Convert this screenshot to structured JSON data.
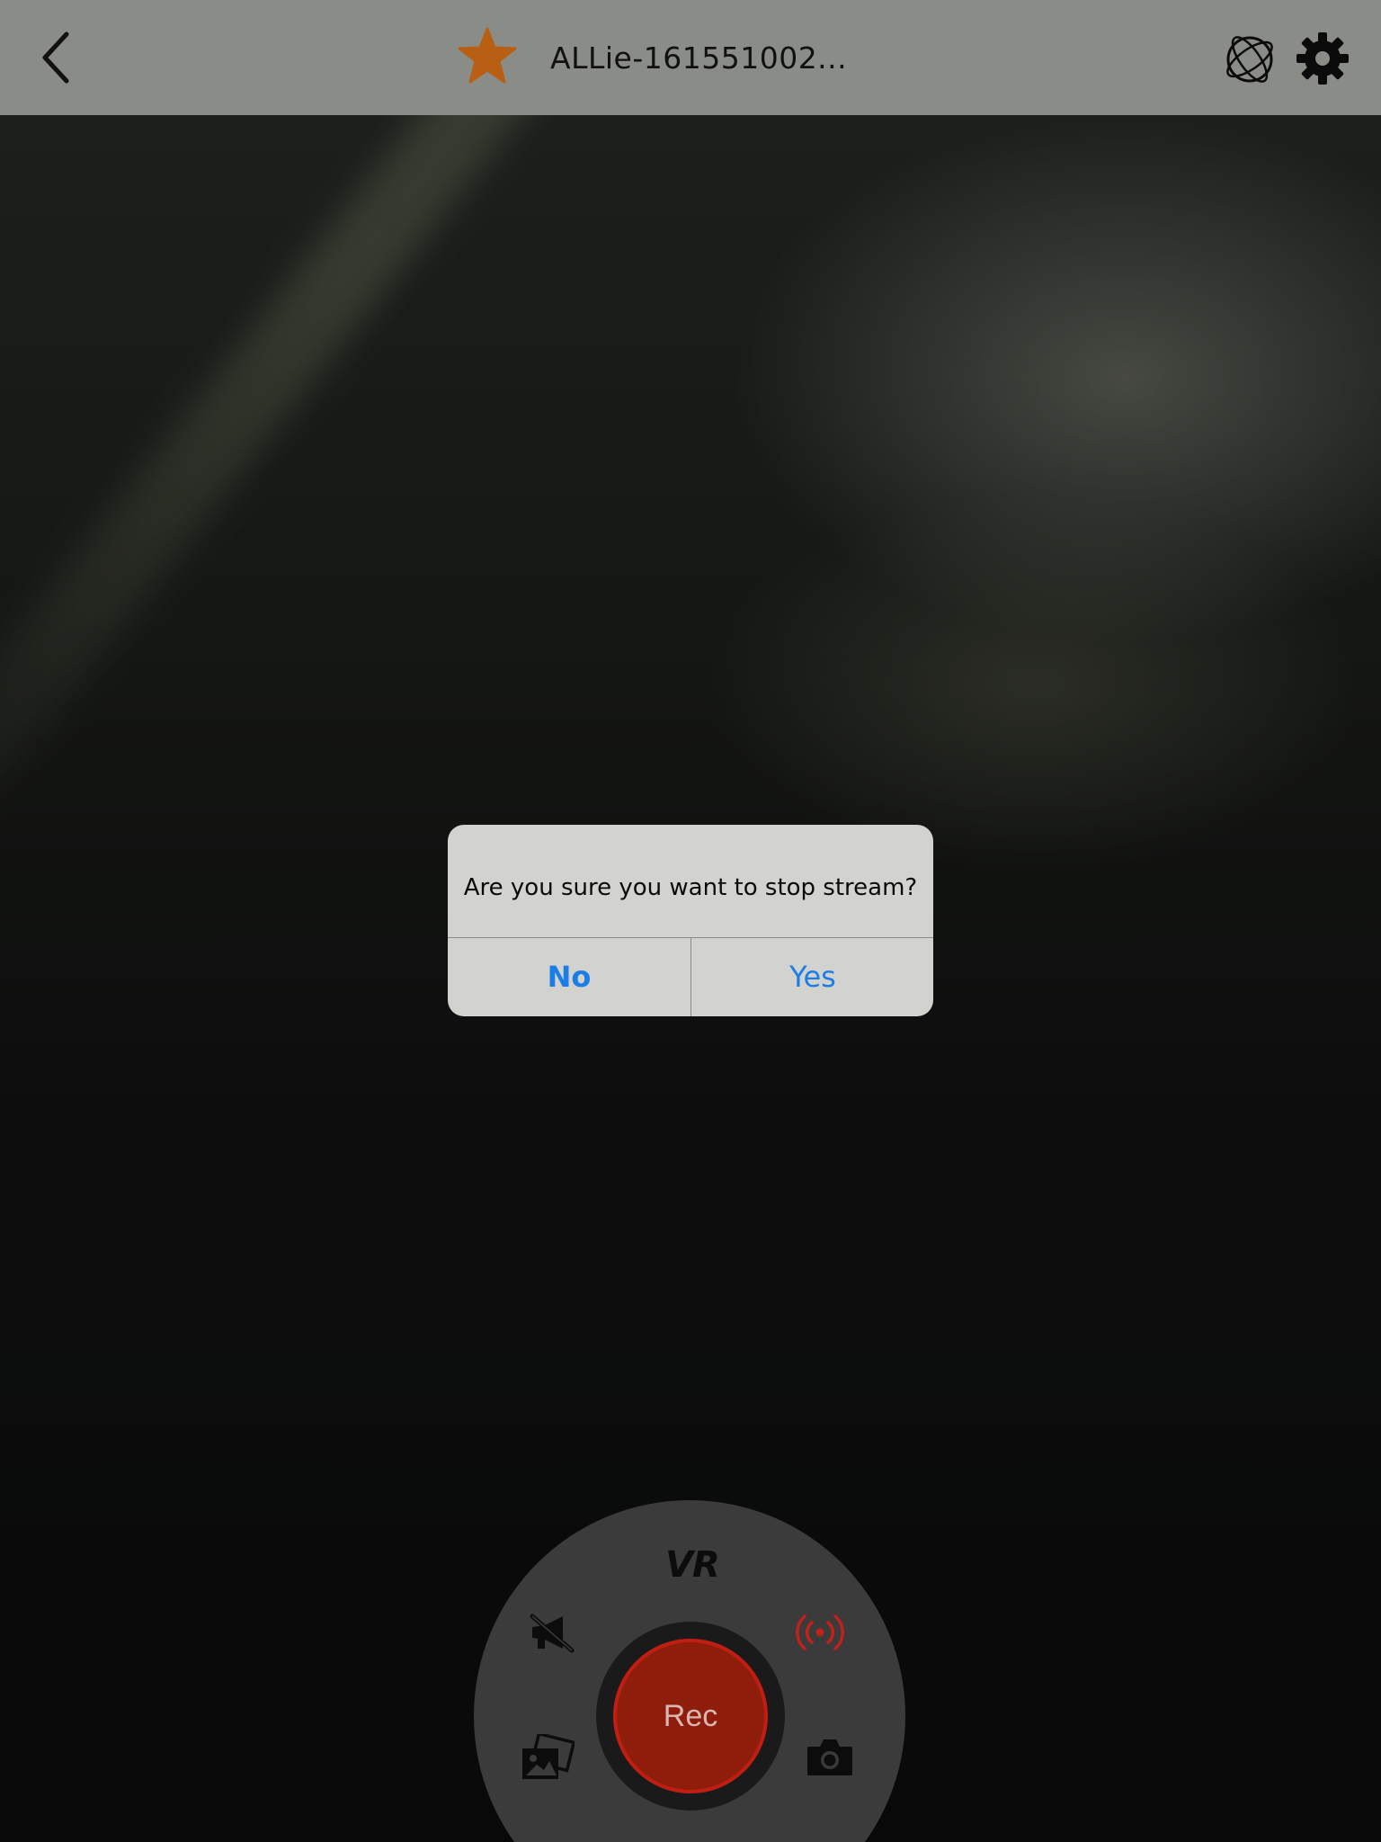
{
  "header": {
    "title": "ALLie-161551002...",
    "favorite_color": "#b85f14"
  },
  "alert": {
    "message": "Are you sure you want to stop stream?",
    "no_label": "No",
    "yes_label": "Yes",
    "button_color": "#1a7ee6"
  },
  "controls": {
    "vr_label": "VR",
    "rec_label": "Rec",
    "rec_color": "#8e1d0c",
    "live_color": "#c0211a",
    "icons": [
      "mute-icon",
      "live-stream-icon",
      "gallery-icon",
      "camera-icon"
    ]
  }
}
